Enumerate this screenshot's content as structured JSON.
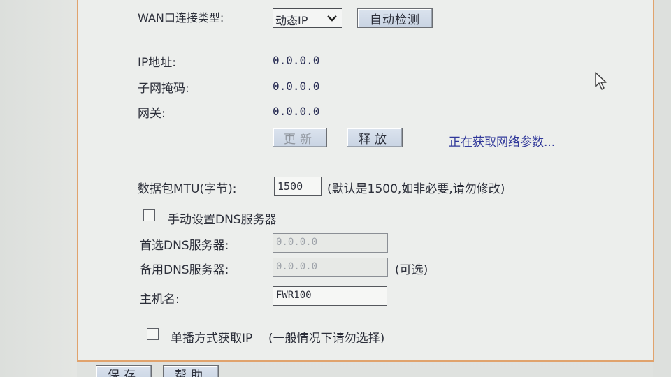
{
  "wan": {
    "type_label": "WAN口连接类型:",
    "type_value": "动态IP",
    "auto_detect_label": "自动检测"
  },
  "ip": {
    "ip_label": "IP地址:",
    "ip_value": "0.0.0.0",
    "mask_label": "子网掩码:",
    "mask_value": "0.0.0.0",
    "gateway_label": "网关:",
    "gateway_value": "0.0.0.0"
  },
  "actions": {
    "renew_label": "更新",
    "release_label": "释放",
    "status": "正在获取网络参数..."
  },
  "mtu": {
    "label": "数据包MTU(字节):",
    "value": "1500",
    "hint": "(默认是1500,如非必要,请勿修改)"
  },
  "dns": {
    "manual_label": "手动设置DNS服务器",
    "manual_checked": false,
    "primary_label": "首选DNS服务器:",
    "primary_value": "0.0.0.0",
    "secondary_label": "备用DNS服务器:",
    "secondary_value": "0.0.0.0",
    "secondary_hint": "(可选)"
  },
  "host": {
    "label": "主机名:",
    "value": "FWR100"
  },
  "unicast": {
    "label": "单播方式获取IP",
    "hint": "(一般情况下请勿选择)",
    "checked": false
  },
  "footer": {
    "save_label": "保存",
    "help_label": "帮助"
  }
}
